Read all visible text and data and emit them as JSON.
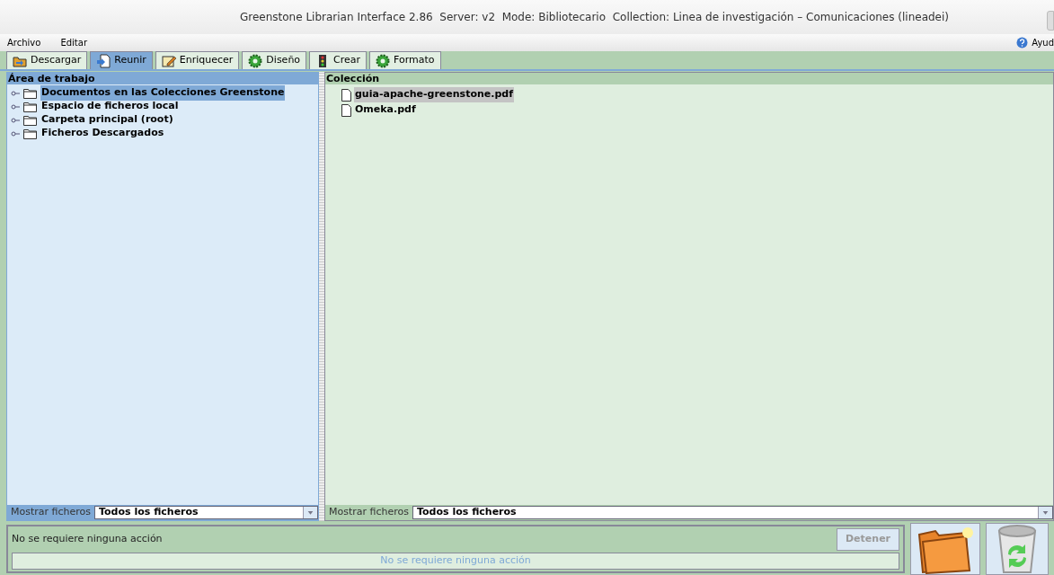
{
  "window": {
    "title": "Greenstone Librarian Interface 2.86  Server: v2  Mode: Bibliotecario  Collection: Linea de investigación – Comunicaciones (lineadei)"
  },
  "menu": [
    "Archivo",
    "Editar"
  ],
  "help": {
    "label": "Ayud"
  },
  "tabs": [
    {
      "label": "Descargar",
      "selected": false,
      "kind": "download"
    },
    {
      "label": "Reunir",
      "selected": true,
      "kind": "gather"
    },
    {
      "label": "Enriquecer",
      "selected": false,
      "kind": "enrich"
    },
    {
      "label": "Diseño",
      "selected": false,
      "kind": "gear"
    },
    {
      "label": "Crear",
      "selected": false,
      "kind": "create"
    },
    {
      "label": "Formato",
      "selected": false,
      "kind": "gear"
    }
  ],
  "workspace": {
    "title": "Área de trabajo",
    "items": [
      {
        "label": "Documentos en las Colecciones Greenstone",
        "selected": true
      },
      {
        "label": "Espacio de ficheros local",
        "selected": false
      },
      {
        "label": "Carpeta principal (root)",
        "selected": false
      },
      {
        "label": "Ficheros Descargados",
        "selected": false
      }
    ],
    "filter": {
      "label": "Mostrar ficheros",
      "value": "Todos los ficheros"
    }
  },
  "collection": {
    "title": "Colección",
    "items": [
      {
        "label": "guia-apache-greenstone.pdf",
        "selected": true
      },
      {
        "label": "Omeka.pdf",
        "selected": false
      }
    ],
    "filter": {
      "label": "Mostrar ficheros",
      "value": "Todos los ficheros"
    }
  },
  "status": {
    "message": "No se requiere ninguna acción",
    "progress_text": "No se requiere ninguna acción",
    "level": 0,
    "stop_button": {
      "label": "Detener",
      "disabled": true
    }
  }
}
